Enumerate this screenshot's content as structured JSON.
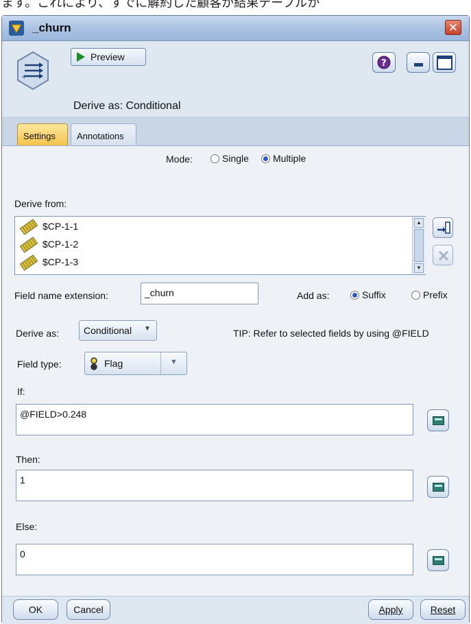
{
  "background_text": "ます。これにより、すでに解約した顧客が結果テーブルか",
  "window": {
    "title": "_churn"
  },
  "header": {
    "preview_label": "Preview",
    "derive_as_title": "Derive as: Conditional"
  },
  "tabs": [
    {
      "label": "Settings",
      "active": true
    },
    {
      "label": "Annotations",
      "active": false
    }
  ],
  "mode": {
    "label": "Mode:",
    "options": [
      {
        "label": "Single",
        "selected": false
      },
      {
        "label": "Multiple",
        "selected": true
      }
    ]
  },
  "derive_from": {
    "label": "Derive from:",
    "items": [
      "$CP-1-1",
      "$CP-1-2",
      "$CP-1-3"
    ]
  },
  "field_name_extension": {
    "label": "Field name extension:",
    "value": "_churn"
  },
  "add_as": {
    "label": "Add as:",
    "options": [
      {
        "label": "Suffix",
        "selected": true
      },
      {
        "label": "Prefix",
        "selected": false
      }
    ]
  },
  "derive_as": {
    "label": "Derive as:",
    "value": "Conditional"
  },
  "tip": "TIP: Refer to selected fields by using @FIELD",
  "field_type": {
    "label": "Field type:",
    "value": "Flag"
  },
  "if_expr": {
    "label": "If:",
    "value": "@FIELD>0.248"
  },
  "then_expr": {
    "label": "Then:",
    "value": "1"
  },
  "else_expr": {
    "label": "Else:",
    "value": "0"
  },
  "buttons": {
    "ok": "OK",
    "cancel": "Cancel",
    "apply": "Apply",
    "reset": "Reset"
  }
}
